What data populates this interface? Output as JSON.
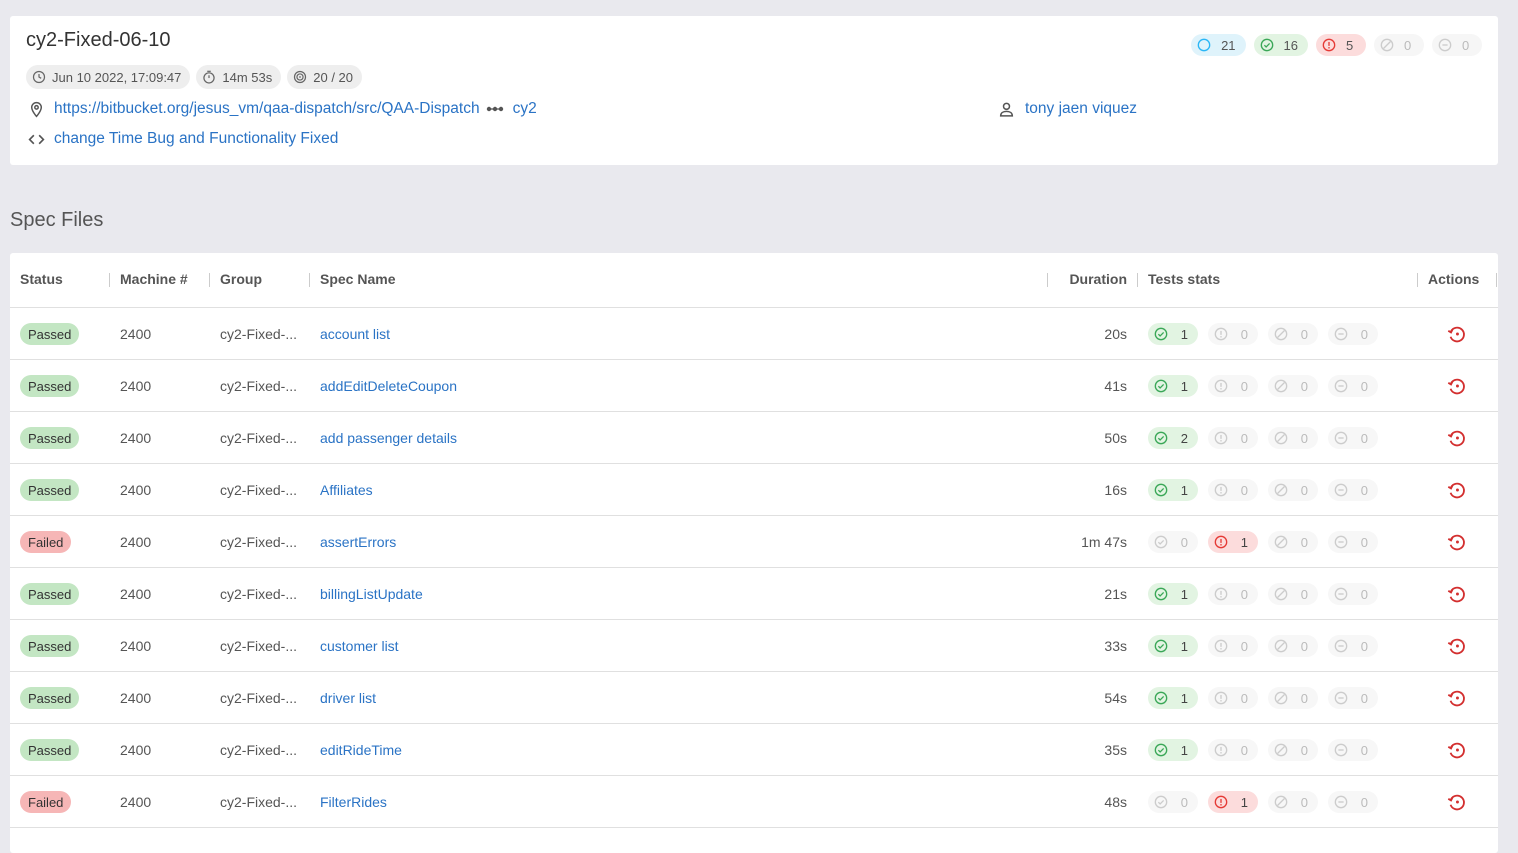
{
  "run": {
    "title": "cy2-Fixed-06-10",
    "date": "Jun 10 2022, 17:09:47",
    "duration": "14m 53s",
    "specs_progress": "20 / 20",
    "repo_url": "https://bitbucket.org/jesus_vm/qaa-dispatch/src/QAA-Dispatch",
    "branch": "cy2",
    "author": "tony jaen viquez",
    "commit_message": "change Time Bug and Functionality Fixed"
  },
  "summary": {
    "total": "21",
    "passed": "16",
    "failed": "5",
    "skipped": "0",
    "pending": "0"
  },
  "section_title": "Spec Files",
  "columns": {
    "status": "Status",
    "machine": "Machine #",
    "group": "Group",
    "spec": "Spec Name",
    "duration": "Duration",
    "stats": "Tests stats",
    "actions": "Actions"
  },
  "rows": [
    {
      "status": "Passed",
      "machine": "2400",
      "group": "cy2-Fixed-...",
      "spec": "account list",
      "duration": "20s",
      "passed": "1",
      "failed": "0",
      "skipped": "0",
      "pending": "0"
    },
    {
      "status": "Passed",
      "machine": "2400",
      "group": "cy2-Fixed-...",
      "spec": "addEditDeleteCoupon",
      "duration": "41s",
      "passed": "1",
      "failed": "0",
      "skipped": "0",
      "pending": "0"
    },
    {
      "status": "Passed",
      "machine": "2400",
      "group": "cy2-Fixed-...",
      "spec": "add passenger details",
      "duration": "50s",
      "passed": "2",
      "failed": "0",
      "skipped": "0",
      "pending": "0"
    },
    {
      "status": "Passed",
      "machine": "2400",
      "group": "cy2-Fixed-...",
      "spec": "Affiliates",
      "duration": "16s",
      "passed": "1",
      "failed": "0",
      "skipped": "0",
      "pending": "0"
    },
    {
      "status": "Failed",
      "machine": "2400",
      "group": "cy2-Fixed-...",
      "spec": "assertErrors",
      "duration": "1m 47s",
      "passed": "0",
      "failed": "1",
      "skipped": "0",
      "pending": "0"
    },
    {
      "status": "Passed",
      "machine": "2400",
      "group": "cy2-Fixed-...",
      "spec": "billingListUpdate",
      "duration": "21s",
      "passed": "1",
      "failed": "0",
      "skipped": "0",
      "pending": "0"
    },
    {
      "status": "Passed",
      "machine": "2400",
      "group": "cy2-Fixed-...",
      "spec": "customer list",
      "duration": "33s",
      "passed": "1",
      "failed": "0",
      "skipped": "0",
      "pending": "0"
    },
    {
      "status": "Passed",
      "machine": "2400",
      "group": "cy2-Fixed-...",
      "spec": "driver list",
      "duration": "54s",
      "passed": "1",
      "failed": "0",
      "skipped": "0",
      "pending": "0"
    },
    {
      "status": "Passed",
      "machine": "2400",
      "group": "cy2-Fixed-...",
      "spec": "editRideTime",
      "duration": "35s",
      "passed": "1",
      "failed": "0",
      "skipped": "0",
      "pending": "0"
    },
    {
      "status": "Failed",
      "machine": "2400",
      "group": "cy2-Fixed-...",
      "spec": "FilterRides",
      "duration": "48s",
      "passed": "0",
      "failed": "1",
      "skipped": "0",
      "pending": "0"
    }
  ],
  "colors": {
    "link": "#2a73c5",
    "pass": "#3aa757",
    "fail": "#e53935",
    "total": "#29b6f6"
  }
}
